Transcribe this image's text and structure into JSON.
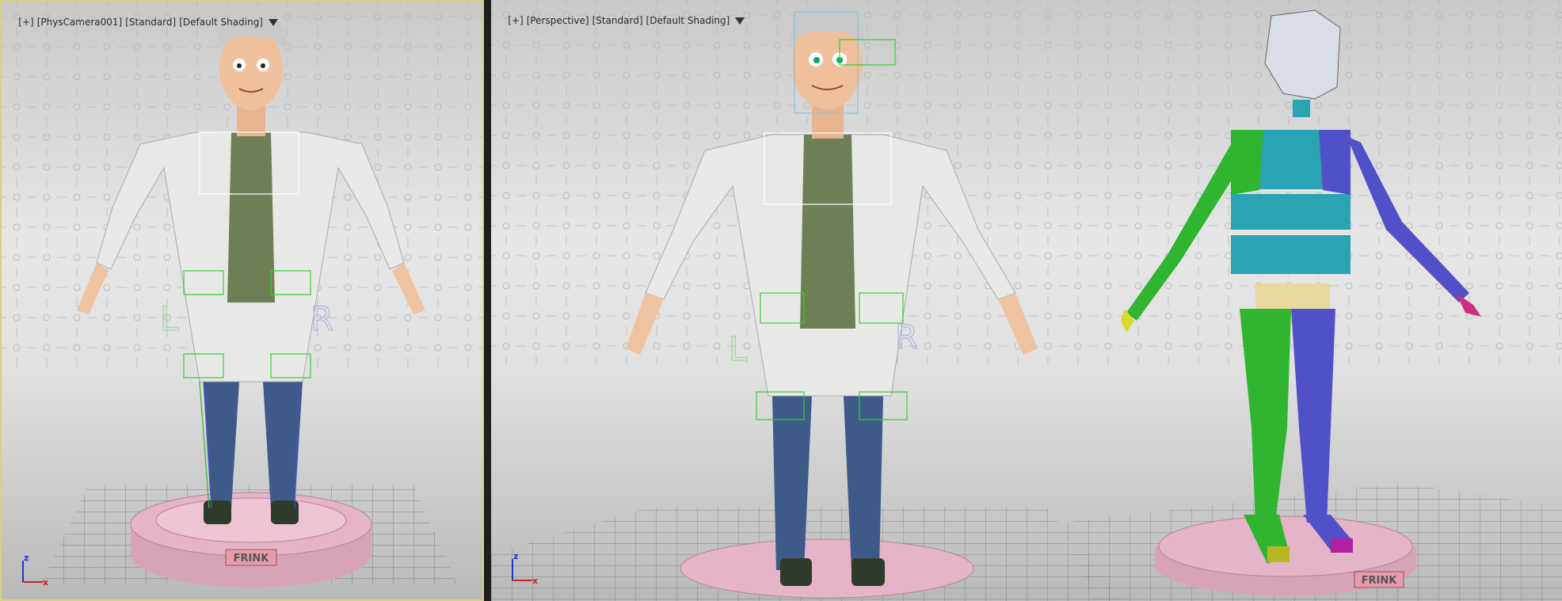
{
  "viewports": [
    {
      "id": "left",
      "labels": [
        "[+]",
        "[PhysCamera001]",
        "[Standard]",
        "[Default Shading]"
      ]
    },
    {
      "id": "right",
      "labels": [
        "[+]",
        "[Perspective]",
        "[Standard]",
        "[Default Shading]"
      ]
    }
  ],
  "rig_labels": {
    "left": "L",
    "right": "R"
  },
  "plinth_text": "FRINK",
  "axis": {
    "x": "x",
    "z": "z"
  },
  "colors": {
    "active_border": "#d8d27a",
    "plinth": "#e6b4c8",
    "coat": "#e8e8e6",
    "shirt": "#6f7f55",
    "jeans": "#3d5a88",
    "biped_left": "#2fb52f",
    "biped_right": "#5050c8",
    "biped_torso": "#2aa3b3",
    "biped_pelvis": "#e7d9a0"
  }
}
